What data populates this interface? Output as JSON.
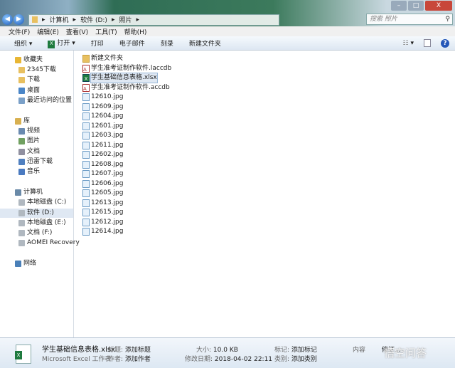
{
  "window": {
    "minimize": "–",
    "maximize": "□",
    "close": "X"
  },
  "address": {
    "crumbs": [
      "计算机",
      "软件 (D:)",
      "照片"
    ],
    "search_placeholder": "搜索 照片"
  },
  "menu": [
    "文件(F)",
    "编辑(E)",
    "查看(V)",
    "工具(T)",
    "帮助(H)"
  ],
  "toolbar": {
    "organize": "组织 ▾",
    "open": "打开 ▾",
    "print": "打印",
    "email": "电子邮件",
    "burn": "刻录",
    "new_folder": "新建文件夹",
    "views": "▾",
    "help": "?"
  },
  "sidebar": [
    {
      "label": "收藏夹",
      "color": "#e8b634",
      "indent": 0
    },
    {
      "label": "2345下载",
      "color": "#e8c060",
      "indent": 1
    },
    {
      "label": "下载",
      "color": "#e8c060",
      "indent": 1
    },
    {
      "label": "桌面",
      "color": "#4a86c8",
      "indent": 1
    },
    {
      "label": "最近访问的位置",
      "color": "#7aa0c8",
      "indent": 1
    },
    {
      "label": "库",
      "color": "#d8b050",
      "indent": 0,
      "gap": true
    },
    {
      "label": "视频",
      "color": "#6a8ab0",
      "indent": 1
    },
    {
      "label": "图片",
      "color": "#70a060",
      "indent": 1
    },
    {
      "label": "文档",
      "color": "#9090a0",
      "indent": 1
    },
    {
      "label": "迅雷下载",
      "color": "#5080c0",
      "indent": 1
    },
    {
      "label": "音乐",
      "color": "#4a7ac0",
      "indent": 1
    },
    {
      "label": "计算机",
      "color": "#6a8aa8",
      "indent": 0,
      "gap": true
    },
    {
      "label": "本地磁盘 (C:)",
      "color": "#b0b8c0",
      "indent": 1
    },
    {
      "label": "软件 (D:)",
      "color": "#b0b8c0",
      "indent": 1,
      "selected": true
    },
    {
      "label": "本地磁盘 (E:)",
      "color": "#b0b8c0",
      "indent": 1
    },
    {
      "label": "文档 (F:)",
      "color": "#b0b8c0",
      "indent": 1
    },
    {
      "label": "AOMEI Recovery",
      "color": "#b0b8c0",
      "indent": 1
    },
    {
      "label": "网络",
      "color": "#4a80b8",
      "indent": 0,
      "gap": true
    }
  ],
  "files": [
    {
      "name": "新建文件夹",
      "type": "folder"
    },
    {
      "name": "学生准考证制作软件.laccdb",
      "type": "access"
    },
    {
      "name": "学生基础信息表格.xlsx",
      "type": "excel",
      "selected": true
    },
    {
      "name": "学生准考证制作软件.accdb",
      "type": "access"
    },
    {
      "name": "12610.jpg",
      "type": "jpg"
    },
    {
      "name": "12609.jpg",
      "type": "jpg"
    },
    {
      "name": "12604.jpg",
      "type": "jpg"
    },
    {
      "name": "12601.jpg",
      "type": "jpg"
    },
    {
      "name": "12603.jpg",
      "type": "jpg"
    },
    {
      "name": "12611.jpg",
      "type": "jpg"
    },
    {
      "name": "12602.jpg",
      "type": "jpg"
    },
    {
      "name": "12608.jpg",
      "type": "jpg"
    },
    {
      "name": "12607.jpg",
      "type": "jpg"
    },
    {
      "name": "12606.jpg",
      "type": "jpg"
    },
    {
      "name": "12605.jpg",
      "type": "jpg"
    },
    {
      "name": "12613.jpg",
      "type": "jpg"
    },
    {
      "name": "12615.jpg",
      "type": "jpg"
    },
    {
      "name": "12612.jpg",
      "type": "jpg"
    },
    {
      "name": "12614.jpg",
      "type": "jpg"
    }
  ],
  "details": {
    "filename": "学生基础信息表格.xlsx",
    "filetype": "Microsoft Excel 工作表",
    "title_label": "标题:",
    "title_value": "添加标题",
    "author_label": "作者:",
    "author_value": "添加作者",
    "size_label": "大小:",
    "size_value": "10.0 KB",
    "modified_label": "修改日期:",
    "modified_value": "2018-04-02 22:11",
    "tags_label": "标记:",
    "tags_value": "添加标记",
    "category_label": "类别:",
    "category_value": "添加类别",
    "content_label": "内容",
    "content_value": "修订..."
  },
  "watermark": "悟空问答"
}
